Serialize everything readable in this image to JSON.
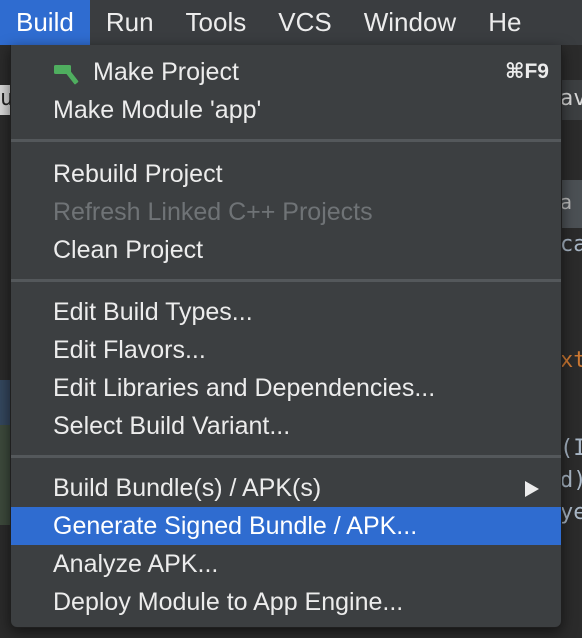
{
  "menubar": {
    "items": [
      {
        "label": "Build",
        "active": true
      },
      {
        "label": "Run"
      },
      {
        "label": "Tools"
      },
      {
        "label": "VCS"
      },
      {
        "label": "Window"
      },
      {
        "label": "He"
      }
    ]
  },
  "background": {
    "fragments": [
      "u",
      "av",
      "a",
      "ca",
      "xt",
      "(I",
      "d)",
      "ye"
    ]
  },
  "menu": {
    "make_project": {
      "label": "Make Project",
      "shortcut": "⌘F9",
      "icon": "hammer-icon"
    },
    "make_module": {
      "label": "Make Module 'app'"
    },
    "rebuild_project": {
      "label": "Rebuild Project"
    },
    "refresh_linked": {
      "label": "Refresh Linked C++ Projects",
      "disabled": true
    },
    "clean_project": {
      "label": "Clean Project"
    },
    "edit_build_types": {
      "label": "Edit Build Types..."
    },
    "edit_flavors": {
      "label": "Edit Flavors..."
    },
    "edit_libraries": {
      "label": "Edit Libraries and Dependencies..."
    },
    "select_variant": {
      "label": "Select Build Variant..."
    },
    "build_bundle": {
      "label": "Build Bundle(s) / APK(s)",
      "has_submenu": true
    },
    "generate_signed": {
      "label": "Generate Signed Bundle / APK...",
      "highlighted": true
    },
    "analyze_apk": {
      "label": "Analyze APK..."
    },
    "deploy_module": {
      "label": "Deploy Module to App Engine..."
    }
  },
  "colors": {
    "accent": "#2f6cd0",
    "menu_bg": "#3c3f41",
    "menubar_bg": "#3a3d40",
    "disabled_text": "#6f7376"
  }
}
